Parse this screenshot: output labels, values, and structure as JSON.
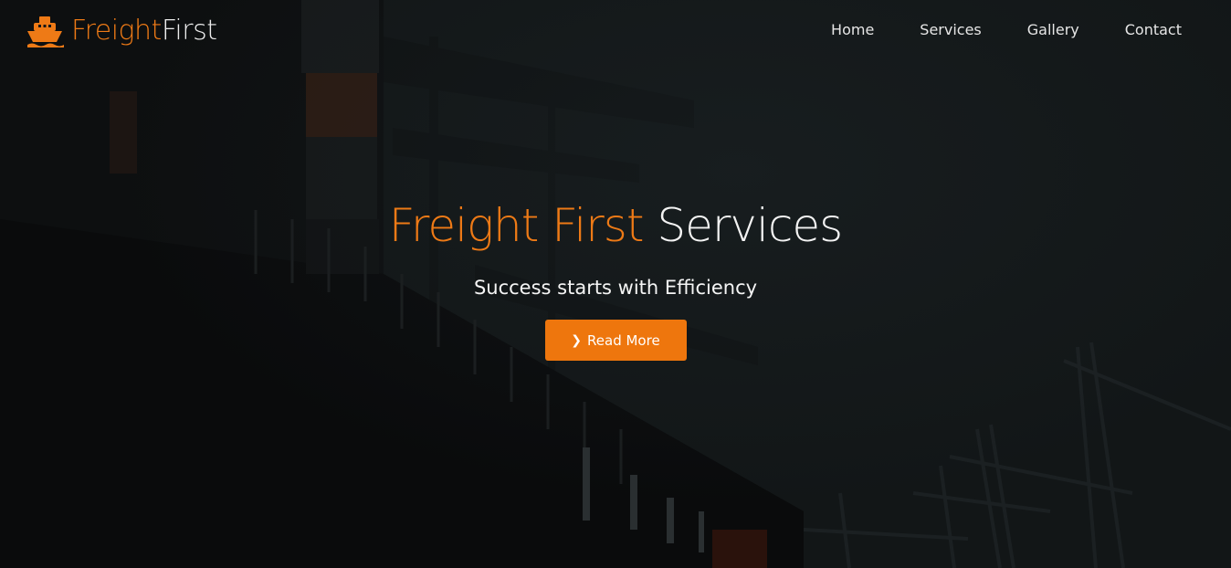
{
  "brand": {
    "icon": "ship-icon",
    "name_part1": "Freight",
    "name_part2": "First",
    "accent_color": "#ee7a16"
  },
  "nav": {
    "items": [
      {
        "label": "Home"
      },
      {
        "label": "Services"
      },
      {
        "label": "Gallery"
      },
      {
        "label": "Contact"
      }
    ]
  },
  "hero": {
    "background_image": "container-ship-port-cranes",
    "title_accent": "Freight First",
    "title_rest": "Services",
    "subtitle": "Success starts with Efficiency",
    "cta": {
      "icon": "chevron-right-icon",
      "label": "Read More",
      "color": "#ee760d"
    }
  }
}
